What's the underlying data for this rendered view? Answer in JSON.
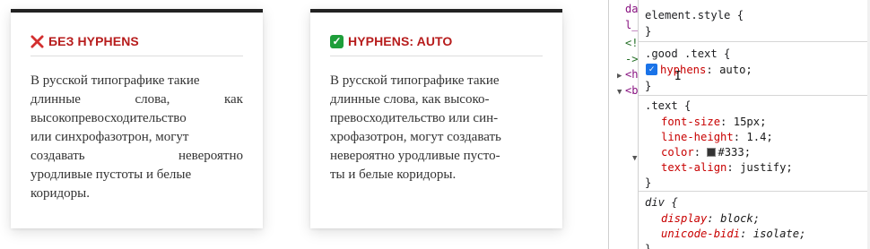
{
  "cards": {
    "bad": {
      "title": "БЕЗ HYPHENS",
      "icon": "x-icon",
      "lines": [
        [
          "В русской типографике такие"
        ],
        [
          "длинные",
          "слова,",
          "как"
        ],
        [
          "высокопревосходительство"
        ],
        [
          "или синхрофазотрон, могут"
        ],
        [
          "создавать",
          "невероятно"
        ],
        [
          "уродливые пустоты и белые"
        ],
        [
          "коридоры."
        ]
      ]
    },
    "good": {
      "title": "HYPHENS: AUTO",
      "icon": "check-icon",
      "lines": [
        "В русской типографике такие",
        "длинные слова, как высоко-",
        "превосходительство или син-",
        "хрофазотрон, могут создавать",
        "невероятно уродливые пусто-",
        "ты и белые коридоры."
      ]
    }
  },
  "dom": {
    "lines": [
      "da",
      "l_",
      "<!",
      "->",
      "<h",
      "<b"
    ]
  },
  "styles": {
    "element_style": {
      "selector": "element.style {",
      "close": "}"
    },
    "good_rule": {
      "selector": ".good .text {",
      "prop": "hyphens",
      "value": "auto;",
      "close": "}"
    },
    "text_rule": {
      "selector": ".text {",
      "props": [
        {
          "name": "font-size",
          "value": "15px;"
        },
        {
          "name": "line-height",
          "value": "1.4;"
        },
        {
          "name": "color",
          "value": "#333;"
        },
        {
          "name": "text-align",
          "value": "justify;"
        }
      ],
      "close": "}"
    },
    "div_rule": {
      "selector": "div {",
      "props": [
        {
          "name": "display",
          "value": "block;"
        },
        {
          "name": "unicode-bidi",
          "value": "isolate;"
        }
      ],
      "close": "}"
    }
  },
  "colors": {
    "title_red": "#b71c1c",
    "check_green": "#1e9e3a",
    "prop_red": "#c80000",
    "text": "#333333"
  }
}
